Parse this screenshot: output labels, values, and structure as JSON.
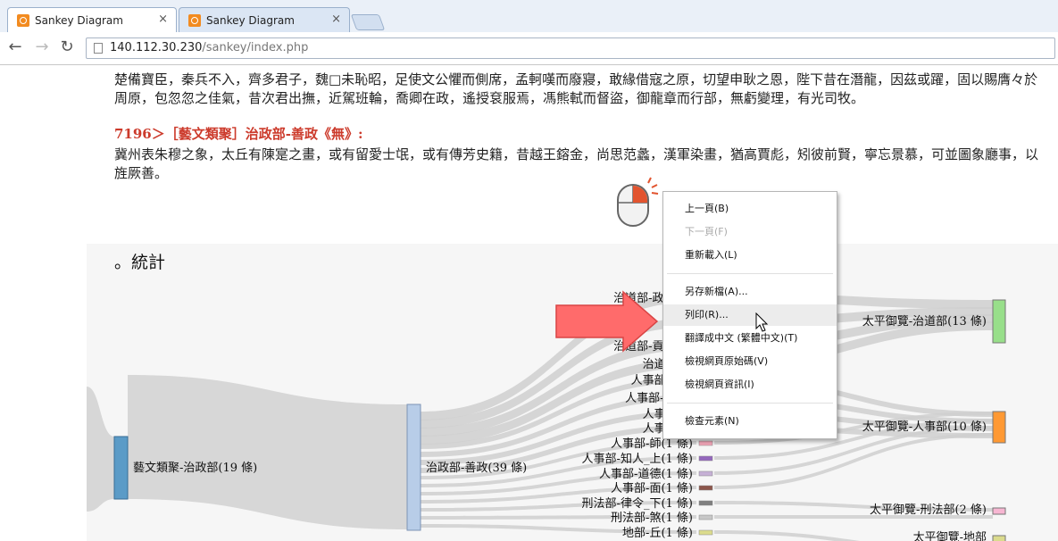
{
  "browser": {
    "tabs": [
      {
        "title": "Sankey Diagram",
        "close": "×"
      },
      {
        "title": "Sankey Diagram",
        "close": "×"
      }
    ],
    "nav": {
      "back": "←",
      "forward": "→",
      "reload": "↻"
    },
    "url": {
      "host": "140.112.30.230",
      "path": "/sankey/index.php"
    }
  },
  "page": {
    "paragraph1": "楚備寶臣，秦兵不入，齊多君子，魏□未恥昭，足使文公懼而側席，孟軻嘆而廢寢，敢緣借寇之原，切望申耿之恩，陛下昔在潛龍，因茲或躍，固以賜膺々於周原，包忽忽之佳氣，昔次君出撫，近駕班輪，喬卿在政，遙授袞服焉，馮熊軾而督盜，御龍章而行部，無虧變理，有光司牧。",
    "heading2": "7196＞［藝文類聚］治政部-善政《無》:",
    "paragraph2": "冀州表朱穆之象，太丘有陳寔之畫，或有留愛士氓，或有傳芳史籍，昔越王鎔金，尚思范蠡，漢軍染畫，猶高賈彪，矧彼前賢，寧忘景慕，可並圖象廳事，以旌厥善。",
    "stats_heading": "。統計"
  },
  "sankey": {
    "source": {
      "label": "藝文類聚-治政部(19 條)",
      "color": "#5b9bc7"
    },
    "middle": {
      "label": "治政部-善政(39 條)",
      "color": "#b8cde8"
    },
    "branches": [
      {
        "label": "治道部-政治_一",
        "color": "#9ecae1"
      },
      {
        "label": "",
        "color": "#9ecae1"
      },
      {
        "label": "治道部-貢賦_上",
        "color": "#9ecae1"
      },
      {
        "label": "治道部-君",
        "color": "#9ecae1"
      },
      {
        "label": "人事部-友悌",
        "color": "#f4a582"
      },
      {
        "label": "人事部-富_下",
        "color": "#f4a582"
      },
      {
        "label": "人事部-信",
        "color": "#f4a582"
      },
      {
        "label": "人事部-喜",
        "color": "#f4a582"
      },
      {
        "label": "人事部-師(1 條)",
        "color": "#f4a7b9"
      },
      {
        "label": "人事部-知人_上(1 條)",
        "color": "#9467bd"
      },
      {
        "label": "人事部-道德(1 條)",
        "color": "#c5b0d5"
      },
      {
        "label": "人事部-面(1 條)",
        "color": "#8c564b"
      },
      {
        "label": "刑法部-律令_下(1 條)",
        "color": "#7f7f7f"
      },
      {
        "label": "刑法部-煞(1 條)",
        "color": "#c7c7c7"
      },
      {
        "label": "地部-丘(1 條)",
        "color": "#dbdb8d"
      }
    ],
    "targets": [
      {
        "label": "太平御覽-治道部(13 條)",
        "color": "#98df8a"
      },
      {
        "label": "太平御覽-人事部(10 條)",
        "color": "#ff9933"
      },
      {
        "label": "太平御覽-刑法部(2 條)",
        "color": "#f7b6d2"
      },
      {
        "label": "太平御覽-地部",
        "color": "#dbdb8d"
      }
    ]
  },
  "context_menu": {
    "items": [
      {
        "label": "上一頁(B)",
        "disabled": false
      },
      {
        "label": "下一頁(F)",
        "disabled": true
      },
      {
        "label": "重新載入(L)",
        "disabled": false
      },
      {
        "label": "另存新檔(A)...",
        "disabled": false
      },
      {
        "label": "列印(R)...",
        "disabled": false,
        "hover": true
      },
      {
        "label": "翻譯成中文 (繁體中文)(T)",
        "disabled": false
      },
      {
        "label": "檢視網頁原始碼(V)",
        "disabled": false
      },
      {
        "label": "檢視網頁資訊(I)",
        "disabled": false
      },
      {
        "label": "檢查元素(N)",
        "disabled": false
      }
    ]
  },
  "overlays": {
    "arrow_color": "#ff6b6b",
    "mouse_icon": "mouse-click-icon",
    "cursor_icon": "arrow-cursor-icon"
  }
}
